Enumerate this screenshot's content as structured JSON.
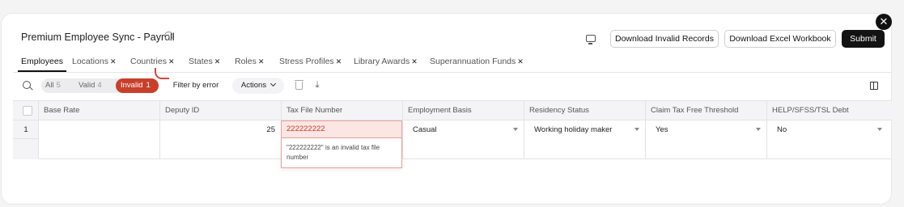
{
  "header": {
    "title": "Premium Employee Sync - Payroll",
    "info_icon": "info-icon",
    "screen_icon": "screen-icon",
    "close_icon": "close-icon",
    "buttons": {
      "download_invalid": "Download Invalid Records",
      "download_excel": "Download Excel Workbook",
      "submit": "Submit"
    }
  },
  "tabs": [
    {
      "label": "Employees",
      "active": true,
      "status_icon": ""
    },
    {
      "label": "Locations",
      "active": false,
      "status_icon": "error-icon"
    },
    {
      "label": "Countries",
      "active": false,
      "status_icon": "error-icon"
    },
    {
      "label": "States",
      "active": false,
      "status_icon": "error-icon"
    },
    {
      "label": "Roles",
      "active": false,
      "status_icon": "error-icon"
    },
    {
      "label": "Stress Profiles",
      "active": false,
      "status_icon": "error-icon"
    },
    {
      "label": "Library Awards",
      "active": false,
      "status_icon": "error-icon"
    },
    {
      "label": "Superannuation Funds",
      "active": false,
      "status_icon": "error-icon"
    }
  ],
  "toolbar": {
    "filters": {
      "all": {
        "label": "All",
        "count": "5"
      },
      "valid": {
        "label": "Valid",
        "count": "4"
      },
      "invalid": {
        "label": "Invalid",
        "count": "1"
      }
    },
    "filter_by_error": "Filter by error",
    "actions": "Actions"
  },
  "table": {
    "columns": [
      "Base Rate",
      "Deputy ID",
      "Tax File Number",
      "Employment Basis",
      "Residency Status",
      "Claim Tax Free Threshold",
      "HELP/SFSS/TSL Debt"
    ],
    "rows": [
      {
        "row_number": "1",
        "base_rate": "",
        "deputy_id": "25",
        "tax_file_number": "222222222",
        "employment_basis": "Casual",
        "residency_status": "Working holiday maker",
        "claim_tax_free_threshold": "Yes",
        "help_debt": "No"
      }
    ],
    "error_message": "\"222222222\" is an invalid tax file number"
  },
  "colors": {
    "accent_error": "#c8402a",
    "primary_button": "#131313"
  }
}
